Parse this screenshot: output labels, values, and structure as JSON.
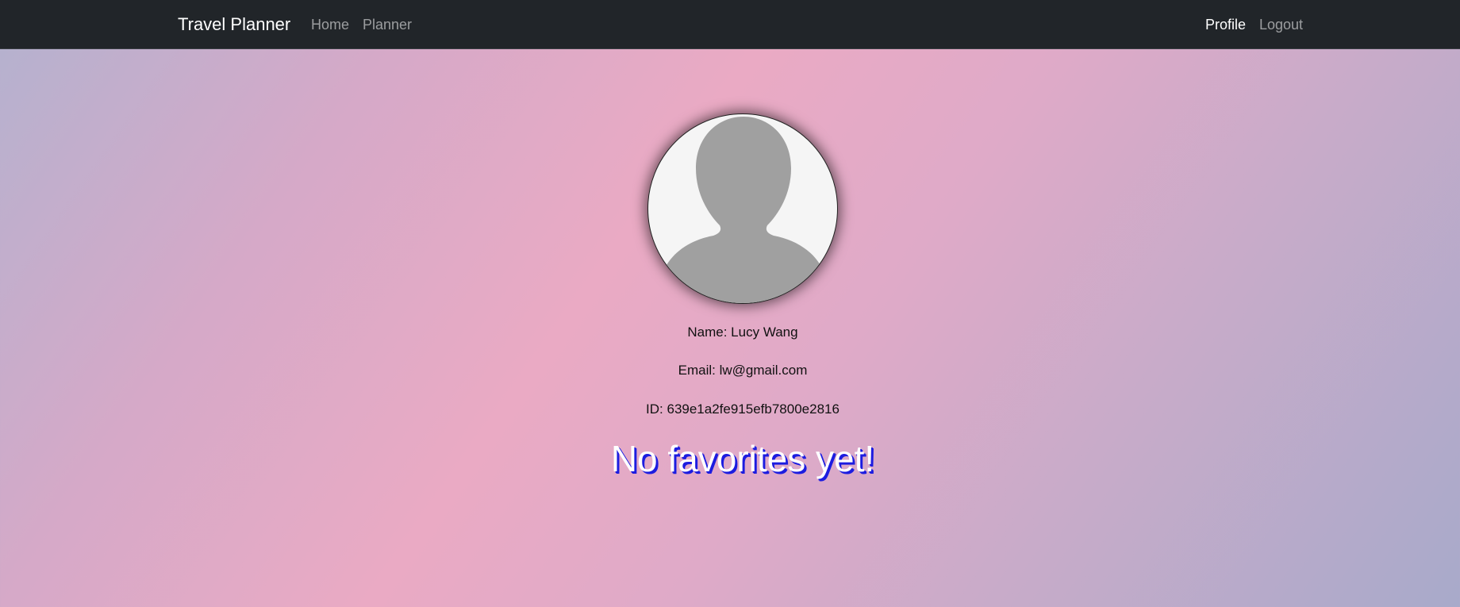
{
  "navbar": {
    "brand": "Travel Planner",
    "links": {
      "home": "Home",
      "planner": "Planner",
      "profile": "Profile",
      "logout": "Logout"
    }
  },
  "profile": {
    "avatar_icon": "person-silhouette-icon",
    "name": "Name: Lucy Wang",
    "email": "Email: lw@gmail.com",
    "id": "ID: 639e1a2fe915efb7800e2816"
  },
  "favorites": {
    "message": "No favorites yet!"
  },
  "colors": {
    "navbar_bg": "#212529",
    "favorites_shadow": "#1c1ce0"
  }
}
